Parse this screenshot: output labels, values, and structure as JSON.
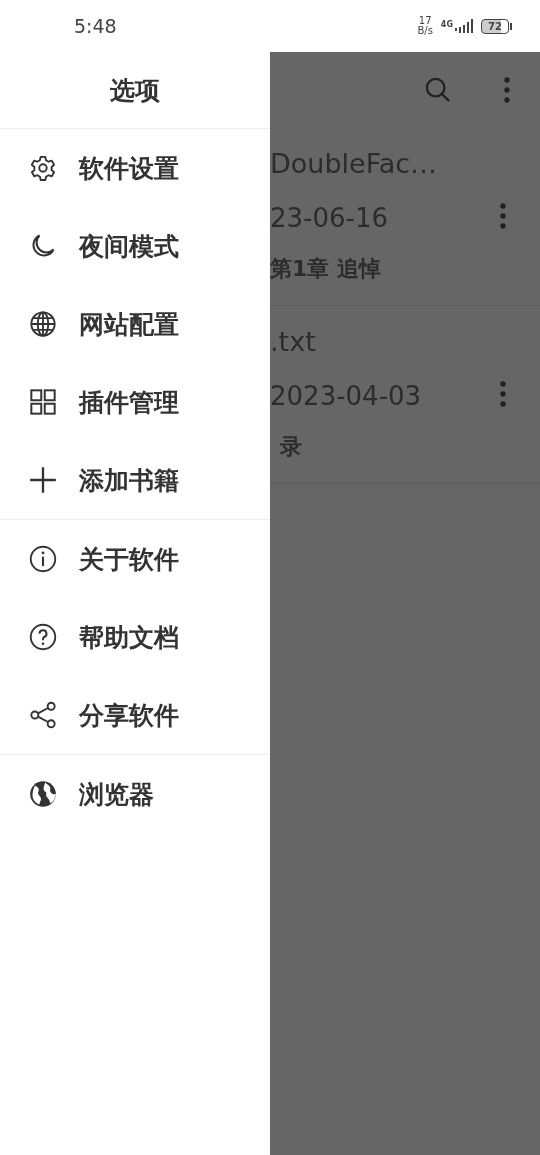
{
  "status_bar": {
    "time": "5:48",
    "speed_value": "17",
    "speed_unit": "B/s",
    "network": "4G",
    "battery": "72"
  },
  "drawer": {
    "title": "选项",
    "groups": [
      {
        "items": [
          {
            "label": "软件设置"
          },
          {
            "label": "夜间模式"
          },
          {
            "label": "网站配置"
          },
          {
            "label": "插件管理"
          },
          {
            "label": "添加书籍"
          }
        ]
      },
      {
        "items": [
          {
            "label": "关于软件"
          },
          {
            "label": "帮助文档"
          },
          {
            "label": "分享软件"
          }
        ]
      },
      {
        "items": [
          {
            "label": "浏览器"
          }
        ]
      }
    ]
  },
  "books": [
    {
      "title": "DoubleFac…",
      "date": "23-06-16",
      "chapter": "第1章 追悼"
    },
    {
      "title": ".txt",
      "date": "2023-04-03",
      "chapter": "录"
    }
  ]
}
